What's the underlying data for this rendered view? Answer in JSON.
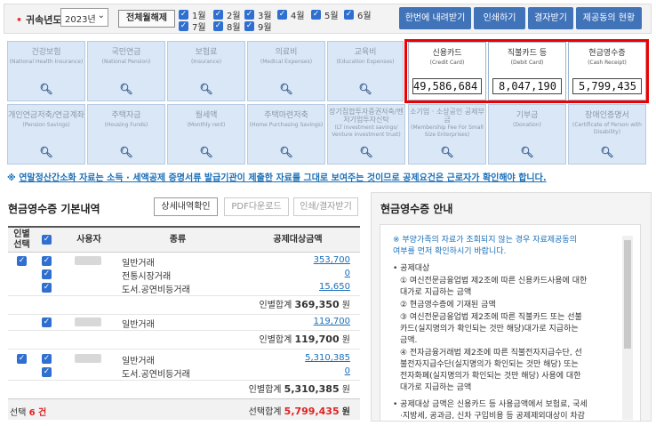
{
  "topbar": {
    "year_label": "귀속년도",
    "year_value": "2023년",
    "select_all_label": "전체월해제",
    "months": [
      "1월",
      "2월",
      "3월",
      "4월",
      "5월",
      "6월",
      "7월",
      "8월",
      "9월"
    ],
    "buttons": [
      "한번에 내려받기",
      "인쇄하기",
      "결자받기",
      "제공동의 현황"
    ]
  },
  "tiles_row1": [
    {
      "name": "건강보험",
      "en": "(National Health Insurance)"
    },
    {
      "name": "국민연금",
      "en": "(National Pension)"
    },
    {
      "name": "보험료",
      "en": "(Insurance)"
    },
    {
      "name": "의료비",
      "en": "(Medical Expenses)"
    },
    {
      "name": "교육비",
      "en": "(Education Expenses)"
    },
    {
      "name": "신용카드",
      "en": "(Credit Card)",
      "value": "49,586,684"
    },
    {
      "name": "직불카드 등",
      "en": "(Debit Card)",
      "value": "8,047,190"
    },
    {
      "name": "현금영수증",
      "en": "(Cash Receipt)",
      "value": "5,799,435"
    }
  ],
  "tiles_row2": [
    {
      "name": "개인연금저축/연금계좌",
      "en": "(Pension Savings)"
    },
    {
      "name": "주택자금",
      "en": "(Housing Funds)"
    },
    {
      "name": "월세액",
      "en": "(Monthly rent)"
    },
    {
      "name": "주택마련저축",
      "en": "(Home Purchasing Savings)"
    },
    {
      "name": "장기집합투자증권저축/벤처기업투자신탁",
      "en": "(LT investment savings/ Venture investment trust)"
    },
    {
      "name": "소기업 · 소상공인 공제부금",
      "en": "(Membership Fee For Small Size Enterprises)"
    },
    {
      "name": "기부금",
      "en": "(Donation)"
    },
    {
      "name": "장애인증명서",
      "en": "(Certificate of Person with Disability)"
    }
  ],
  "notice": {
    "prefix": "※ ",
    "text": "연말정산간소화 자료는 소득 · 세액공제 증명서류 발급기관이 제출한 자료를 그대로 보여주는 것이므로 공제요건은 근로자가 확인해야 합니다."
  },
  "left_panel": {
    "title": "현금영수증 기본내역",
    "buttons": [
      "상세내역확인",
      "PDF다운로드",
      "인쇄/결자받기"
    ],
    "headers": {
      "inherit": "인별\n선택",
      "person": "사용자",
      "kind": "종류",
      "amount": "공제대상금액"
    },
    "groups": [
      {
        "rows": [
          {
            "kind": "일반거래",
            "amount": "353,700"
          },
          {
            "kind": "전통시장거래",
            "amount": "0"
          },
          {
            "kind": "도서.공연비등거래",
            "amount": "15,650"
          }
        ],
        "subtotal_label": "인별합계",
        "subtotal": "369,350",
        "unit": "원"
      },
      {
        "rows": [
          {
            "kind": "일반거래",
            "amount": "119,700"
          }
        ],
        "subtotal_label": "인별합계",
        "subtotal": "119,700",
        "unit": "원"
      },
      {
        "rows": [
          {
            "kind": "일반거래",
            "amount": "5,310,385"
          },
          {
            "kind": "도서.공연비등거래",
            "amount": "0"
          }
        ],
        "subtotal_label": "인별합계",
        "subtotal": "5,310,385",
        "unit": "원"
      }
    ],
    "footer": {
      "selected_label": "선택",
      "selected_count": "6 건",
      "total_label": "선택합계",
      "total": "5,799,435",
      "unit": "원"
    }
  },
  "right_panel": {
    "title": "현금영수증 안내",
    "lines": [
      {
        "t": "※ 부양가족의 자료가 조회되지 않는 경우 자료제공동의",
        "c": "bl"
      },
      {
        "t": "여부를 먼저 확인하시기 바랍니다.",
        "c": "bl"
      },
      {
        "t": "• 공제대상",
        "c": ""
      },
      {
        "t": "① 여신전문금융업법 제2조에 따른 신용카드사용에 대한",
        "c": ""
      },
      {
        "t": "대가로 지급하는 금액",
        "c": ""
      },
      {
        "t": "② 현금영수증에 기재된 금액",
        "c": ""
      },
      {
        "t": "③ 여신전문금융업법 제2조에 따른 직불카드 또는 선불",
        "c": ""
      },
      {
        "t": "카드(실지명의가 확인되는 것만 해당)대가로 지급하는",
        "c": ""
      },
      {
        "t": "금액.",
        "c": ""
      },
      {
        "t": "④ 전자금융거래법 제2조에 따른 직불전자지급수단, 선",
        "c": ""
      },
      {
        "t": "불전자지급수단(실지명의가 확인되는 것만 해당) 또는",
        "c": ""
      },
      {
        "t": "전자화폐(실지명의가 확인되는 것만 해당) 사용에 대한",
        "c": ""
      },
      {
        "t": "대가로 지급하는 금액",
        "c": ""
      },
      {
        "t": "• 공제대상 금액은 신용카드 등 사용금액에서 보험료, 국세",
        "c": ""
      },
      {
        "t": "·지방세, 공과금, 신차 구입비용 등 공제제외대상이 차감",
        "c": ""
      }
    ]
  }
}
